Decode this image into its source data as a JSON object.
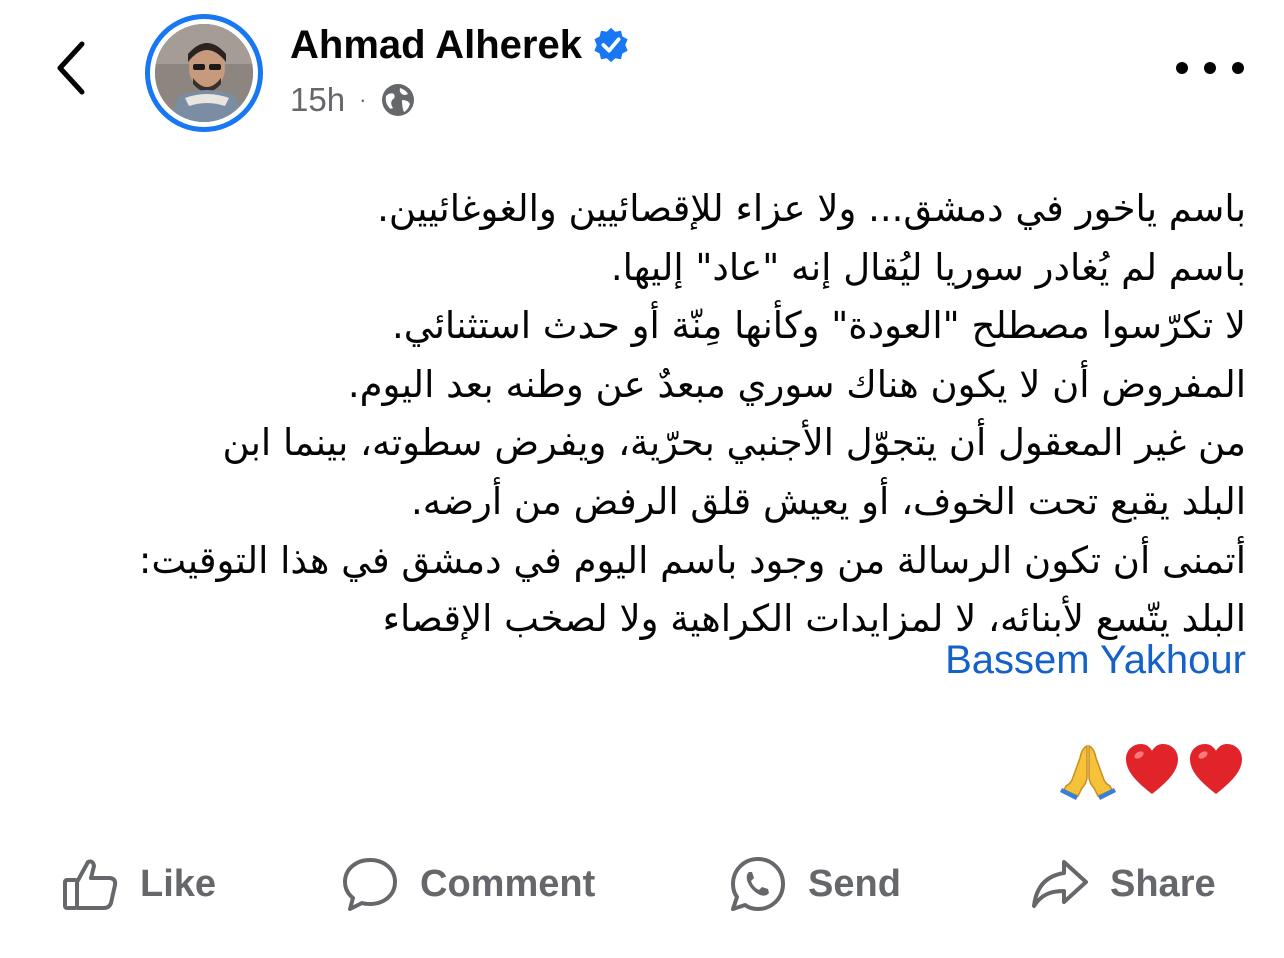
{
  "header": {
    "author_name": "Ahmad Alherek",
    "timestamp": "15h",
    "separator": "·",
    "verified_color": "#1877f2",
    "privacy_icon": "globe-icon",
    "back_icon": "chevron-left-icon",
    "more_icon": "more-horizontal-icon"
  },
  "post": {
    "lines": [
      "باسم ياخور في دمشق... ولا عزاء للإقصائيين والغوغائيين.",
      "باسم لم يُغادر سوريا ليُقال إنه \"عاد\" إليها.",
      "لا تكرّسوا مصطلح \"العودة\" وكأنها مِنّة أو حدث استثنائي.",
      "المفروض أن لا يكون هناك سوري مبعدٌ عن وطنه بعد اليوم.",
      "من غير المعقول أن يتجوّل الأجنبي بحرّية، ويفرض سطوته، بينما ابن",
      "البلد يقبع تحت الخوف، أو يعيش قلق الرفض من أرضه.",
      "أتمنى أن تكون الرسالة من وجود باسم اليوم في دمشق في هذا التوقيت:",
      "البلد يتّسع لأبنائه، لا لمزايدات الكراهية ولا لصخب الإقصاء"
    ],
    "mention": "Bassem Yakhour",
    "mention_color": "#1462c9",
    "emojis": [
      "heart-icon",
      "heart-icon",
      "folded-hands-icon"
    ]
  },
  "actions": {
    "like_label": "Like",
    "comment_label": "Comment",
    "send_label": "Send",
    "share_label": "Share",
    "label_color": "#65676b"
  }
}
